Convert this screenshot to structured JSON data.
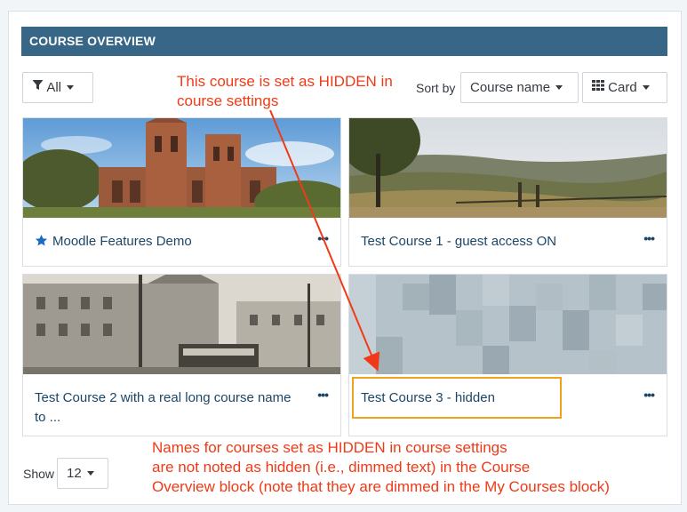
{
  "block": {
    "title": "COURSE OVERVIEW",
    "filter": {
      "icon": "filter-icon",
      "label": "All"
    },
    "sort": {
      "prefix": "Sort by",
      "selected": "Course name"
    },
    "view": {
      "icon": "grid-icon",
      "label": "Card"
    },
    "courses": [
      {
        "title": "Moodle Features Demo",
        "starred": true,
        "menu": "•••"
      },
      {
        "title": "Test Course 1 - guest access ON",
        "starred": false,
        "menu": "•••"
      },
      {
        "title": "Test Course 2 with a real long course name to ...",
        "starred": false,
        "menu": "•••"
      },
      {
        "title": "Test Course 3 - hidden",
        "starred": false,
        "menu": "•••"
      }
    ],
    "pagination": {
      "label": "Show",
      "selected": "12"
    }
  },
  "annotations": {
    "top_note": [
      "This course is set as HIDDEN in",
      "course settings"
    ],
    "bottom_note": [
      "Names for courses set as HIDDEN in course settings",
      "are not noted as hidden (i.e., dimmed text) in the Course",
      "Overview block (note that they are dimmed in the My Courses block)"
    ],
    "color": "#f03a17",
    "box_color": "#f0a21e"
  },
  "colors": {
    "header_bg": "#376687",
    "link": "#1d4666",
    "star": "#1e6bc5"
  }
}
